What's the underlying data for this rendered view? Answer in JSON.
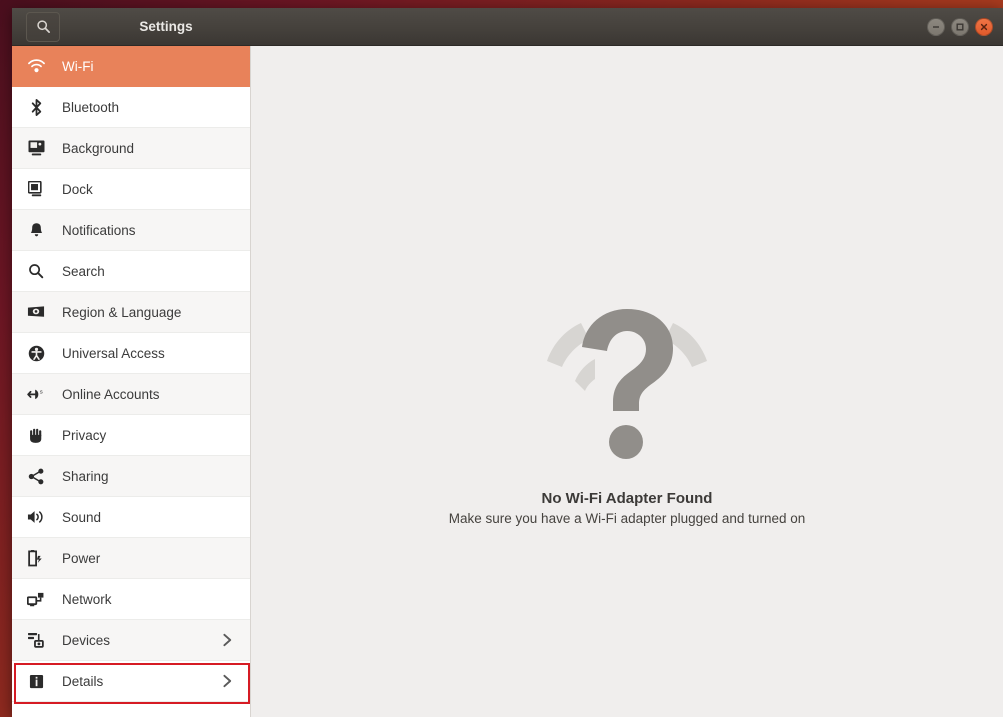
{
  "window": {
    "title": "Settings",
    "search_icon": "search-icon",
    "controls": {
      "minimize": "minimize-button",
      "maximize": "maximize-button",
      "close": "close-button"
    },
    "accent_color": "#e8825a",
    "titlebar_color": "#45413c",
    "content_bg": "#f0eeed",
    "highlight_color": "#d61b24"
  },
  "sidebar": {
    "items": [
      {
        "label": "Wi-Fi",
        "icon": "wifi-icon",
        "selected": true,
        "chevron": false
      },
      {
        "label": "Bluetooth",
        "icon": "bluetooth-icon",
        "selected": false,
        "chevron": false
      },
      {
        "label": "Background",
        "icon": "background-icon",
        "selected": false,
        "chevron": false
      },
      {
        "label": "Dock",
        "icon": "dock-icon",
        "selected": false,
        "chevron": false
      },
      {
        "label": "Notifications",
        "icon": "bell-icon",
        "selected": false,
        "chevron": false
      },
      {
        "label": "Search",
        "icon": "magnifier-icon",
        "selected": false,
        "chevron": false
      },
      {
        "label": "Region & Language",
        "icon": "region-language-icon",
        "selected": false,
        "chevron": false
      },
      {
        "label": "Universal Access",
        "icon": "accessibility-icon",
        "selected": false,
        "chevron": false
      },
      {
        "label": "Online Accounts",
        "icon": "online-accounts-icon",
        "selected": false,
        "chevron": false
      },
      {
        "label": "Privacy",
        "icon": "hand-icon",
        "selected": false,
        "chevron": false
      },
      {
        "label": "Sharing",
        "icon": "share-icon",
        "selected": false,
        "chevron": false
      },
      {
        "label": "Sound",
        "icon": "speaker-icon",
        "selected": false,
        "chevron": false
      },
      {
        "label": "Power",
        "icon": "power-battery-icon",
        "selected": false,
        "chevron": false
      },
      {
        "label": "Network",
        "icon": "network-icon",
        "selected": false,
        "chevron": false
      },
      {
        "label": "Devices",
        "icon": "devices-icon",
        "selected": false,
        "chevron": true,
        "highlighted": true
      },
      {
        "label": "Details",
        "icon": "info-icon",
        "selected": false,
        "chevron": true
      }
    ]
  },
  "main": {
    "empty_state": {
      "icon": "question-mark-wifi-icon",
      "title": "No Wi-Fi Adapter Found",
      "subtitle": "Make sure you have a Wi-Fi adapter plugged and turned on"
    }
  }
}
